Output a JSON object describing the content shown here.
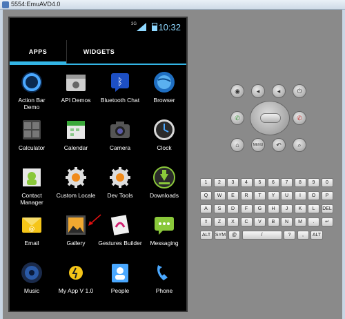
{
  "window": {
    "title": "5554:EmuAVD4.0"
  },
  "status": {
    "time": "10:32",
    "network": "3G"
  },
  "tabs": {
    "apps": "APPS",
    "widgets": "WIDGETS"
  },
  "apps": [
    {
      "label": "Action Bar Demo",
      "icon": "action-bar-demo-icon"
    },
    {
      "label": "API Demos",
      "icon": "api-demos-icon"
    },
    {
      "label": "Bluetooth Chat",
      "icon": "bluetooth-chat-icon"
    },
    {
      "label": "Browser",
      "icon": "browser-icon"
    },
    {
      "label": "Calculator",
      "icon": "calculator-icon"
    },
    {
      "label": "Calendar",
      "icon": "calendar-icon"
    },
    {
      "label": "Camera",
      "icon": "camera-icon"
    },
    {
      "label": "Clock",
      "icon": "clock-icon"
    },
    {
      "label": "Contact Manager",
      "icon": "contact-manager-icon"
    },
    {
      "label": "Custom Locale",
      "icon": "custom-locale-icon"
    },
    {
      "label": "Dev Tools",
      "icon": "dev-tools-icon"
    },
    {
      "label": "Downloads",
      "icon": "downloads-icon"
    },
    {
      "label": "Email",
      "icon": "email-icon"
    },
    {
      "label": "Gallery",
      "icon": "gallery-icon"
    },
    {
      "label": "Gestures Builder",
      "icon": "gestures-builder-icon"
    },
    {
      "label": "Messaging",
      "icon": "messaging-icon"
    },
    {
      "label": "Music",
      "icon": "music-icon"
    },
    {
      "label": "My App V 1.0",
      "icon": "my-app-icon"
    },
    {
      "label": "People",
      "icon": "people-icon"
    },
    {
      "label": "Phone",
      "icon": "phone-icon"
    }
  ],
  "controls": {
    "menu": "MENU"
  },
  "keyboard": {
    "row1": [
      "1",
      "2",
      "3",
      "4",
      "5",
      "6",
      "7",
      "8",
      "9",
      "0"
    ],
    "row2": [
      "Q",
      "W",
      "E",
      "R",
      "T",
      "Y",
      "U",
      "I",
      "O",
      "P"
    ],
    "row3": [
      "A",
      "S",
      "D",
      "F",
      "G",
      "H",
      "J",
      "K",
      "L",
      "DEL"
    ],
    "row4": [
      "⇧",
      "Z",
      "X",
      "C",
      "V",
      "B",
      "N",
      "M",
      ".",
      "↵"
    ],
    "row5": [
      "ALT",
      "SYM",
      "@",
      "/",
      "?",
      ",",
      "ALT"
    ]
  },
  "colors": {
    "accent": "#33b5e5"
  }
}
